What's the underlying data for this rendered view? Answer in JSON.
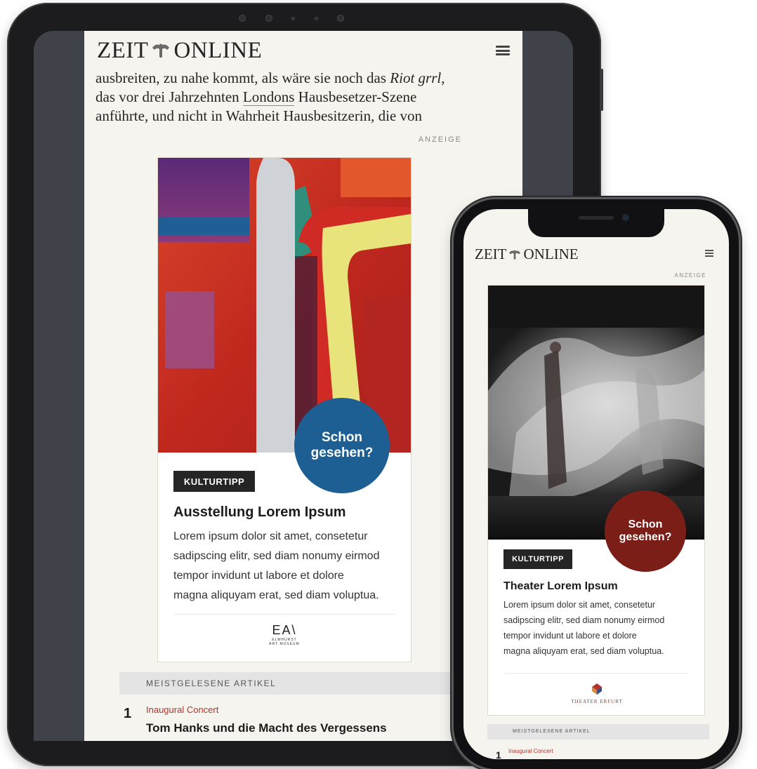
{
  "tablet": {
    "logo": "ZEIT ONLINE",
    "logo_left": "ZEIT",
    "logo_right": "ONLINE",
    "article_lines": [
      [
        "ausbreiten, zu nahe kommt, als wäre sie noch das ",
        "Riot grrl",
        ","
      ],
      [
        "das vor drei Jahrzehnten ",
        "Londons",
        " Hausbesetzer-Szene"
      ],
      [
        "anführte, und nicht in Wahrheit Hausbesitzerin, die von"
      ]
    ],
    "ad_label": "ANZEIGE",
    "ad": {
      "badge": [
        "Schon",
        "gesehen?"
      ],
      "badge_color": "#1d5f92",
      "tag": "KULTURTIPP",
      "title": "Ausstellung Lorem Ipsum",
      "body_lines": [
        "Lorem ipsum dolor sit amet, consetetur",
        "sadipscing elitr, sed diam nonumy eirmod",
        "tempor invidunt ut labore et dolore",
        "magna aliquyam erat, sed diam voluptua."
      ],
      "sponsor_mark": "EA\\",
      "sponsor_line1": "ELMHURST",
      "sponsor_line2": "ART MUSEUM"
    },
    "most_read_label": "MEISTGELESENE ARTIKEL",
    "most_read": [
      {
        "rank": "1",
        "kicker": "Inaugural Concert",
        "headline": "Tom Hanks und die Macht des Vergessens"
      }
    ]
  },
  "phone": {
    "logo_left": "ZEIT",
    "logo_right": "ONLINE",
    "ad_label": "ANZEIGE",
    "ad": {
      "badge": [
        "Schon",
        "gesehen?"
      ],
      "badge_color": "#7b1e17",
      "tag": "KULTURTIPP",
      "title": "Theater Lorem Ipsum",
      "body_lines": [
        "Lorem ipsum dolor sit amet, consetetur",
        "sadipscing elitr, sed diam nonumy eirmod",
        "tempor invidunt ut labore et dolore",
        "magna aliquyam erat, sed diam voluptua."
      ],
      "sponsor": "THEATER ERFURT"
    },
    "most_read_label": "MEISTGELESENE ARTIKEL",
    "most_read": [
      {
        "rank": "1",
        "kicker": "Inaugural Concert"
      }
    ]
  },
  "colors": {
    "page_bg": "#f5f4ef",
    "kicker_red": "#b5332a",
    "tag_dark": "#252525"
  }
}
